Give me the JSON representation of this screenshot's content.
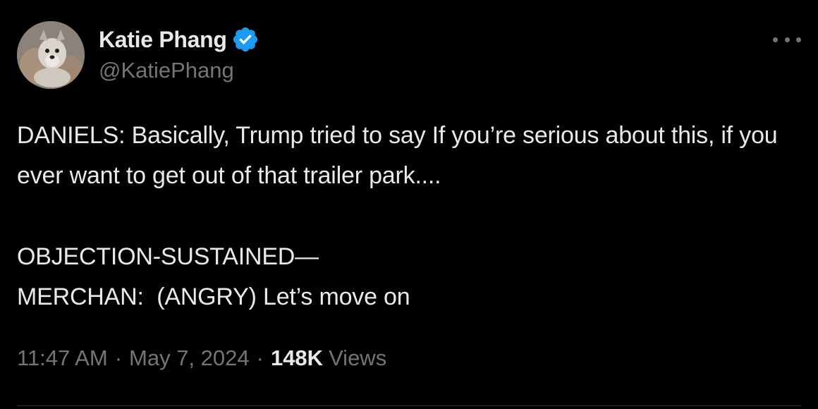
{
  "author": {
    "display_name": "Katie Phang",
    "handle": "@KatiePhang",
    "verified": true
  },
  "tweet": {
    "lines": [
      "DANIELS: Basically, Trump tried to say If you’re serious about this, if you ever want to get out of that trailer park....",
      "OBJECTION-SUSTAINED—",
      "MERCHAN:  (ANGRY) Let’s move on"
    ],
    "time": "11:47 AM",
    "date": "May 7, 2024",
    "separator": "·",
    "views_count": "148K",
    "views_label": "Views"
  },
  "icons": {
    "verified": "verified-badge-icon",
    "more": "more-options-icon"
  },
  "colors": {
    "background": "#000000",
    "primary_text": "#e7e9ea",
    "secondary_text": "#71767b",
    "verified_blue": "#1d9bf0"
  }
}
